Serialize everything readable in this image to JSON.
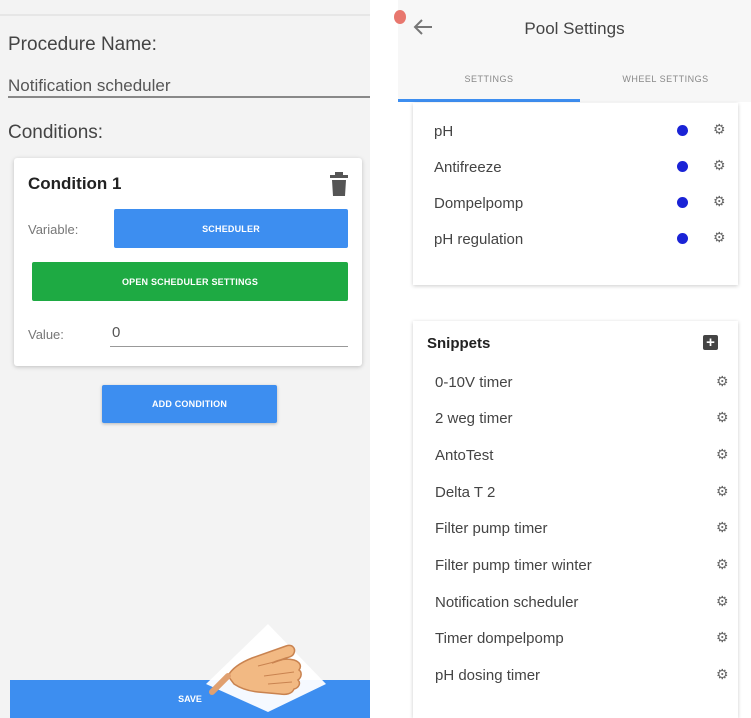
{
  "left": {
    "procedure_label": "Procedure Name:",
    "procedure_value": "Notification scheduler",
    "conditions_label": "Conditions:",
    "condition": {
      "title": "Condition 1",
      "variable_label": "Variable:",
      "scheduler_button": "SCHEDULER",
      "open_settings_button": "OPEN SCHEDULER SETTINGS",
      "value_label": "Value:",
      "value": "0"
    },
    "add_condition_button": "ADD CONDITION",
    "save_button": "SAVE"
  },
  "right": {
    "title": "Pool Settings",
    "tabs": [
      {
        "label": "SETTINGS",
        "active": true
      },
      {
        "label": "WHEEL SETTINGS",
        "active": false
      }
    ],
    "settings_items": [
      {
        "label": "pH",
        "status_color": "#1a23d6"
      },
      {
        "label": "Antifreeze",
        "status_color": "#1a23d6"
      },
      {
        "label": "Dompelpomp",
        "status_color": "#1a23d6"
      },
      {
        "label": "pH regulation",
        "status_color": "#1a23d6"
      }
    ],
    "snippets_title": "Snippets",
    "snippets": [
      "0-10V timer",
      "2 weg timer",
      "AntoTest",
      "Delta T 2",
      "Filter pump timer",
      "Filter pump timer winter",
      "Notification scheduler",
      "Timer dompelpomp",
      "pH dosing timer"
    ]
  },
  "colors": {
    "accent_blue": "#3d8ef0",
    "accent_green": "#1eaa43",
    "status_dot": "#1a23d6"
  },
  "icons": [
    "trash-icon",
    "back-arrow-icon",
    "gear-icon",
    "plus-icon",
    "pointing-hand-icon"
  ]
}
